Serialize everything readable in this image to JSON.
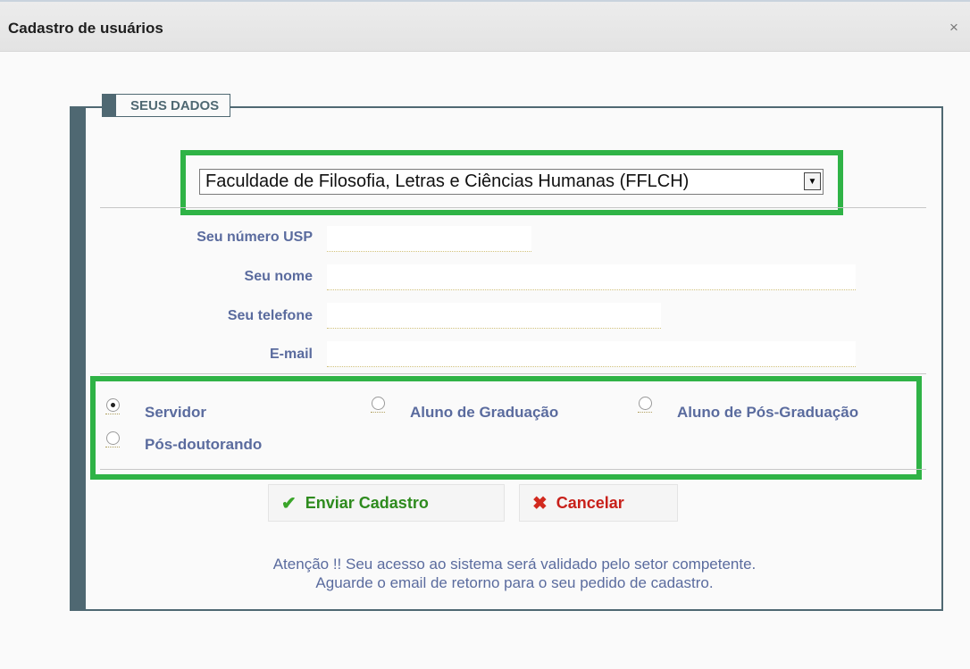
{
  "window": {
    "title": "Cadastro de usuários",
    "close_glyph": "×"
  },
  "fieldset": {
    "legend": "SEUS DADOS"
  },
  "unit_select": {
    "value": "Faculdade de Filosofia, Letras e Ciências Humanas (FFLCH)"
  },
  "fields": [
    {
      "label": "Seu número USP",
      "value": ""
    },
    {
      "label": "Seu nome",
      "value": ""
    },
    {
      "label": "Seu telefone",
      "value": ""
    },
    {
      "label": "E-mail",
      "value": ""
    }
  ],
  "user_types": [
    {
      "label": "Servidor",
      "checked": true
    },
    {
      "label": "Aluno de Graduação",
      "checked": false
    },
    {
      "label": "Aluno de Pós-Graduação",
      "checked": false
    },
    {
      "label": "Pós-doutorando",
      "checked": false
    }
  ],
  "buttons": {
    "submit": {
      "label": "Enviar Cadastro",
      "icon": "check-icon",
      "color": "#2e8b1e"
    },
    "cancel": {
      "label": "Cancelar",
      "icon": "x-icon",
      "color": "#c8201a"
    }
  },
  "notice": {
    "line1": "Atenção !! Seu acesso ao sistema será validado pelo setor competente.",
    "line2": "Aguarde o email de retorno para o seu pedido de cadastro."
  },
  "colors": {
    "highlight": "#2fb346",
    "frame": "#4f6872",
    "label": "#5a6b9e"
  }
}
